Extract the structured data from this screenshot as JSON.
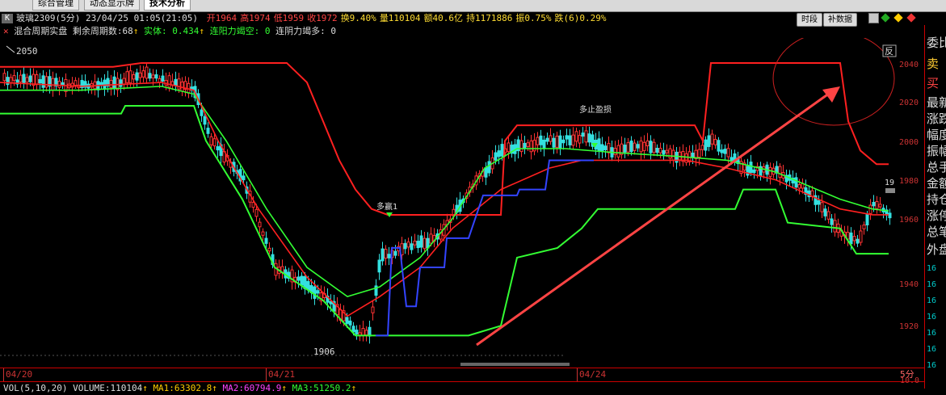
{
  "tabs": [
    "综合管理",
    "动态显示牌",
    "技术分析"
  ],
  "active_tab_index": 2,
  "header": {
    "k_badge": "K",
    "title": "玻璃2309(5分) 23/04/25 01:05(21:05)",
    "open": "开1964",
    "high": "高1974",
    "low": "低1959",
    "close": "收1972",
    "turnover_rate": "换9.40%",
    "volume": "量110104",
    "amount": "额40.6亿",
    "open_interest": "持1171886",
    "amplitude": "振0.75%",
    "change": "跌(6)0.29%"
  },
  "buttons": {
    "period": "时段",
    "supplement": "补数据"
  },
  "indicator": {
    "name": "混合周期实盘",
    "remaining_label": "剩余周期数:68",
    "body_label": "实体: 0.434",
    "yang_label": "连阳力竭空: 0",
    "yin_label": "连阴力竭多: 0"
  },
  "chart": {
    "price_high_label": "2050",
    "price_low_label": "1906",
    "signal_buy": "多赢1",
    "signal_stop": "多止盈损",
    "reverse_badge": "反",
    "y_ticks": [
      "2040",
      "2020",
      "2000",
      "1980",
      "1960",
      "1940",
      "1920"
    ],
    "right_edge_label": "19"
  },
  "dates": [
    "04/20",
    "04/21",
    "04/24"
  ],
  "period_label": "5分",
  "volume_bar": {
    "prefix": "VOL(5,10,20) VOLUME:110104",
    "ma1": "MA1:63302.8",
    "ma2": "MA2:60794.9",
    "ma3": "MA3:51250.2"
  },
  "vol_tick": "10.0",
  "right_panel": {
    "items": [
      "委比",
      "卖",
      "买",
      "最新",
      "涨跌",
      "幅度",
      "振幅",
      "总手",
      "金额",
      "持仓",
      "涨停",
      "总笔",
      "外盘"
    ],
    "numbers": [
      "16",
      "16",
      "16",
      "16",
      "16",
      "16",
      "16"
    ]
  },
  "colors": {
    "up": "#ff3333",
    "down": "#33e0e0",
    "mid_line": "#ff2020",
    "green_line": "#33ff33",
    "blue_line": "#3344ff",
    "axis": "#cc3333",
    "arrow": "#ff4444"
  }
}
